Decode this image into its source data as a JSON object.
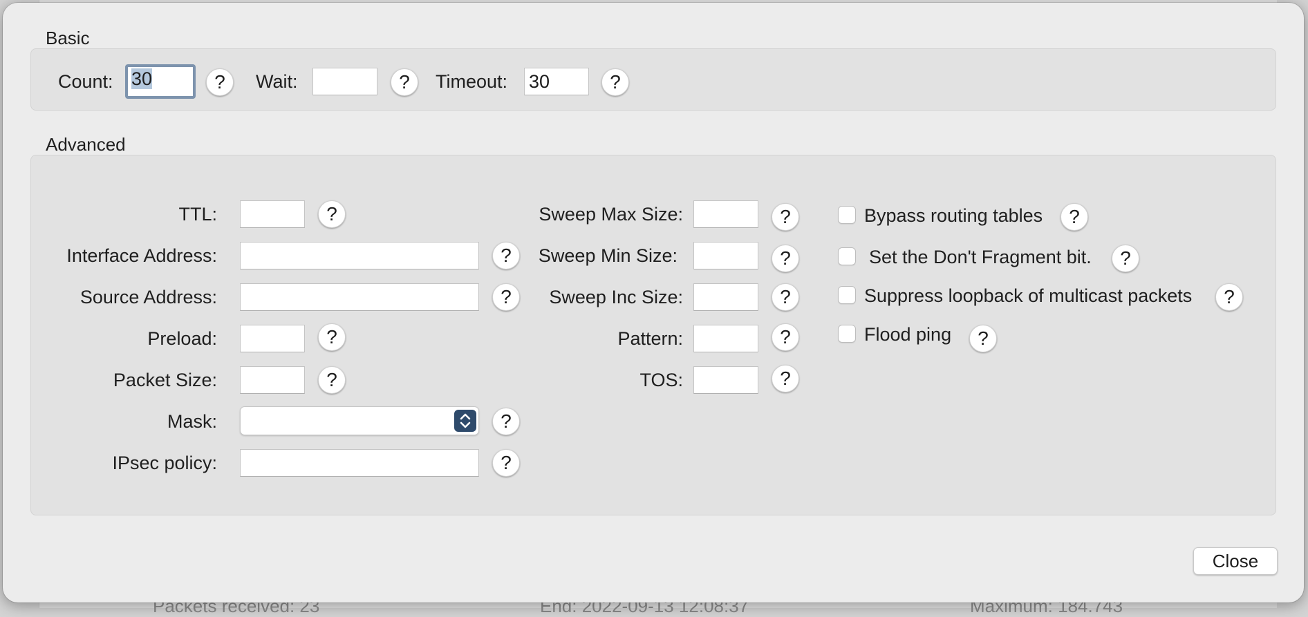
{
  "background": {
    "stats": [
      "Packets received:  23",
      "End:  2022-09-13 12:08:37",
      "Maximum:  184.743"
    ]
  },
  "basic": {
    "title": "Basic",
    "count_label": "Count:",
    "count_value": "30",
    "wait_label": "Wait:",
    "wait_value": "",
    "timeout_label": "Timeout:",
    "timeout_value": "30"
  },
  "advanced": {
    "title": "Advanced",
    "ttl_label": "TTL:",
    "interface_address_label": "Interface Address:",
    "source_address_label": "Source Address:",
    "preload_label": "Preload:",
    "packet_size_label": "Packet Size:",
    "mask_label": "Mask:",
    "mask_value": "",
    "ipsec_policy_label": "IPsec policy:",
    "sweep_max_size_label": "Sweep Max Size:",
    "sweep_min_size_label": "Sweep Min Size:",
    "sweep_inc_size_label": "Sweep Inc Size:",
    "pattern_label": "Pattern:",
    "tos_label": "TOS:",
    "bypass_routing_label": "Bypass routing tables",
    "dont_fragment_label": "Set the Don't Fragment bit.",
    "suppress_loopback_label": "Suppress loopback of multicast packets",
    "flood_ping_label": "Flood ping"
  },
  "help_glyph": "?",
  "close_label": "Close",
  "colors": {
    "sheet_background": "#ececec",
    "group_background": "#e2e2e2",
    "focus_ring": "#7d93ad",
    "stepper": "#2e4a6b"
  }
}
